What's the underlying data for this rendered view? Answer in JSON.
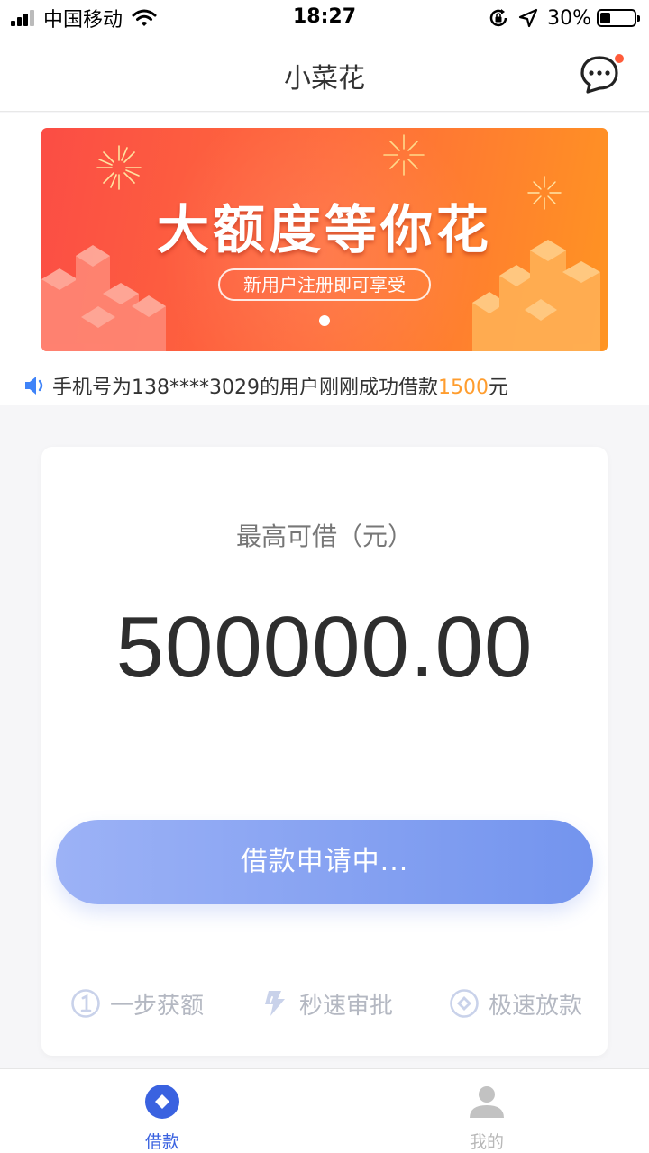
{
  "status_bar": {
    "carrier": "中国移动",
    "time": "18:27",
    "battery_percent": "30%",
    "battery_level": 0.3
  },
  "nav": {
    "title": "小菜花",
    "message_icon": "chat-bubble-icon"
  },
  "banner": {
    "title": "大额度等你花",
    "subtitle": "新用户注册即可享受",
    "colors": {
      "start": "#fb4d45",
      "end": "#ff9422"
    }
  },
  "marquee": {
    "prefix": "手机号为138****3029的用户刚刚成功借款",
    "amount": "1500",
    "suffix": "元"
  },
  "loan_card": {
    "label": "最高可借（元）",
    "amount": "500000.00",
    "button_label": "借款申请中...",
    "features": [
      {
        "icon": "step-one-icon",
        "label": "一步获额"
      },
      {
        "icon": "lightning-icon",
        "label": "秒速审批"
      },
      {
        "icon": "diamond-coin-icon",
        "label": "极速放款"
      }
    ]
  },
  "tab_bar": {
    "tabs": [
      {
        "icon": "loan-tab-icon",
        "label": "借款",
        "active": true
      },
      {
        "icon": "profile-tab-icon",
        "label": "我的",
        "active": false
      }
    ],
    "active_color": "#3a62e0",
    "inactive_color": "#b8b8b8"
  }
}
